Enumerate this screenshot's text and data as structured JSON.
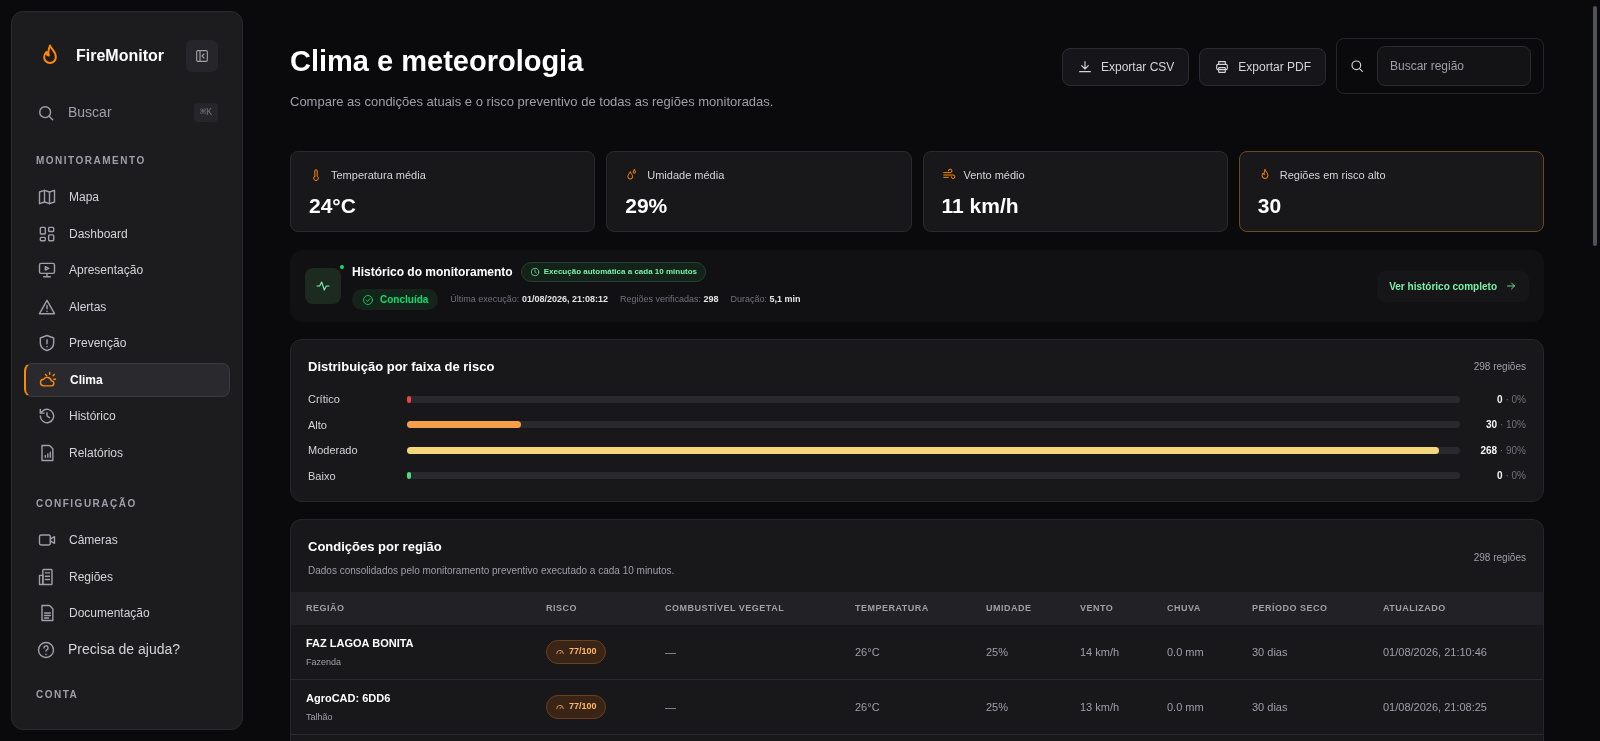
{
  "sidebar": {
    "brand": "FireMonitor",
    "search": {
      "label": "Buscar",
      "shortcut": "⌘K"
    },
    "sections": [
      {
        "title": "MONITORAMENTO",
        "items": [
          {
            "label": "Mapa",
            "selected": false
          },
          {
            "label": "Dashboard",
            "selected": false
          },
          {
            "label": "Apresentação",
            "selected": false
          },
          {
            "label": "Alertas",
            "selected": false
          },
          {
            "label": "Prevenção",
            "selected": false
          },
          {
            "label": "Clima",
            "selected": true
          },
          {
            "label": "Histórico",
            "selected": false
          },
          {
            "label": "Relatórios",
            "selected": false
          }
        ]
      },
      {
        "title": "CONFIGURAÇÃO",
        "items": [
          {
            "label": "Câmeras",
            "selected": false
          },
          {
            "label": "Regiões",
            "selected": false
          },
          {
            "label": "Documentação",
            "selected": false
          }
        ]
      }
    ],
    "help": "Precisa de ajuda?",
    "next_section": "CONTA"
  },
  "header": {
    "title": "Clima e meteorologia",
    "subtitle": "Compare as condições atuais e o risco preventivo de todas as regiões monitoradas.",
    "buttons": [
      "Exportar CSV",
      "Exportar PDF"
    ],
    "search": {
      "placeholder": "Buscar região"
    }
  },
  "stats": [
    {
      "label": "Temperatura média",
      "value": "24°C",
      "highlighted": false
    },
    {
      "label": "Umidade média",
      "value": "29%",
      "highlighted": false
    },
    {
      "label": "Vento médio",
      "value": "11 km/h",
      "highlighted": false
    },
    {
      "label": "Regiões em risco alto",
      "value": "30",
      "highlighted": true
    }
  ],
  "history": {
    "title": "Histórico do monitoramento",
    "schedule": "Execução automática a cada 10 minutos",
    "status": "Concluída",
    "details": [
      {
        "label": "Última execução:",
        "value": "01/08/2026, 21:08:12"
      },
      {
        "label": "Regiões verificadas:",
        "value": "298"
      },
      {
        "label": "Duração:",
        "value": "5,1 min"
      }
    ],
    "link": "Ver histórico completo"
  },
  "distribution": {
    "title": "Distribuição por faixa de risco",
    "count": "298 regiões",
    "bands": [
      {
        "label": "Crítico",
        "level": 0,
        "count": "0",
        "percent": "· 0%",
        "color": "#ef4444"
      },
      {
        "label": "Alto",
        "level": 0.108,
        "count": "30",
        "percent": "· 10%",
        "color": "#f59e4b"
      },
      {
        "label": "Moderado",
        "level": 0.98,
        "count": "268",
        "percent": "· 90%",
        "color": "#f3d77a"
      },
      {
        "label": "Baixo",
        "level": 0,
        "count": "0",
        "percent": "· 0%",
        "color": "#4ade80"
      }
    ]
  },
  "table": {
    "title": "Condições por região",
    "subtitle": "Dados consolidados pelo monitoramento preventivo executado a cada 10 minutos.",
    "count": "298 regiões",
    "columns": [
      "REGIÃO",
      "RISCO",
      "COMBUSTÍVEL VEGETAL",
      "TEMPERATURA",
      "UMIDADE",
      "VENTO",
      "CHUVA",
      "PERÍODO SECO",
      "ATUALIZADO"
    ],
    "rows": [
      {
        "name": "FAZ LAGOA BONITA",
        "type": "Fazenda",
        "risk": "77/100",
        "fuel": "—",
        "temperature": "26°C",
        "humidity": "25%",
        "wind": "14 km/h",
        "rain": "0.0 mm",
        "dry": "30 dias",
        "updated": "01/08/2026, 21:10:46"
      },
      {
        "name": "AgroCAD: 6DD6",
        "type": "Talhão",
        "risk": "77/100",
        "fuel": "—",
        "temperature": "26°C",
        "humidity": "25%",
        "wind": "13 km/h",
        "rain": "0.0 mm",
        "dry": "30 dias",
        "updated": "01/08/2026, 21:08:25"
      }
    ]
  }
}
